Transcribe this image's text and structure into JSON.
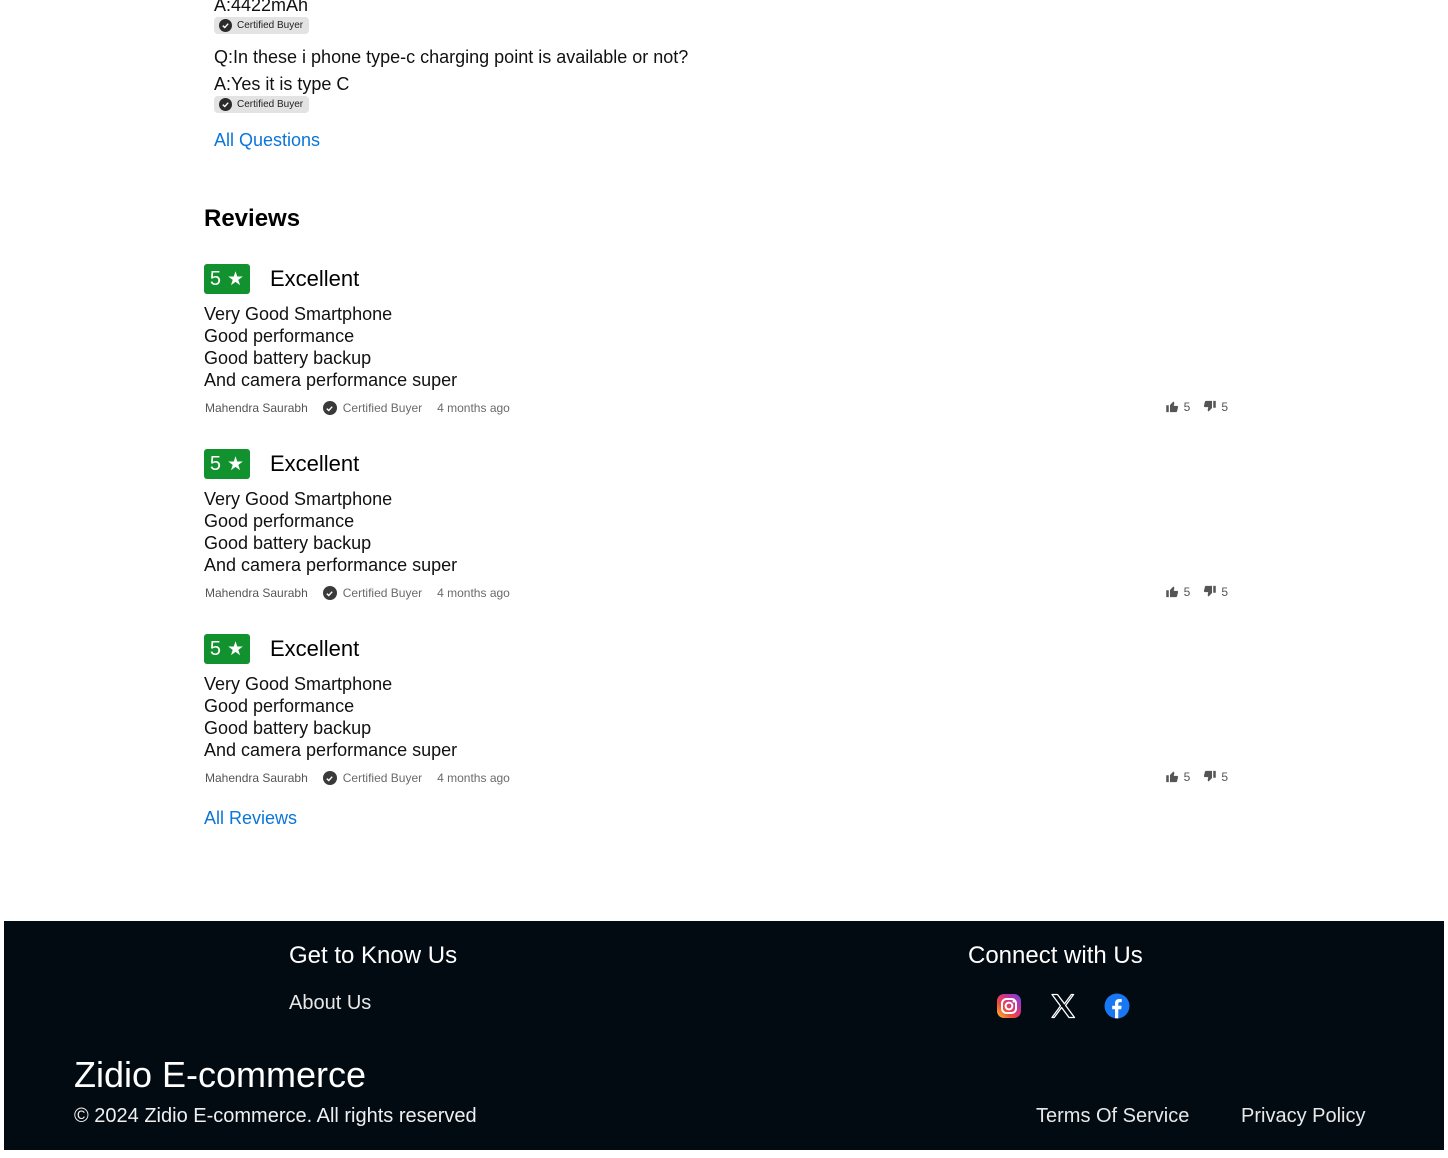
{
  "qa": {
    "prev_answer": "A:4422mAh",
    "certified_label": "Certified Buyer",
    "question": "Q:In these i phone type-c charging point is available or not?",
    "answer": "A:Yes it is type C",
    "all_questions": "All Questions"
  },
  "reviews": {
    "title": "Reviews",
    "all_reviews": "All Reviews",
    "items": [
      {
        "rating": "5",
        "headline": "Excellent",
        "lines": [
          "Very Good Smartphone",
          "Good performance",
          "Good battery backup",
          "And camera performance super"
        ],
        "author": "Mahendra Saurabh",
        "certified": "Certified Buyer",
        "time": "4 months ago",
        "likes": "5",
        "dislikes": "5"
      },
      {
        "rating": "5",
        "headline": "Excellent",
        "lines": [
          "Very Good Smartphone",
          "Good performance",
          "Good battery backup",
          "And camera performance super"
        ],
        "author": "Mahendra Saurabh",
        "certified": "Certified Buyer",
        "time": "4 months ago",
        "likes": "5",
        "dislikes": "5"
      },
      {
        "rating": "5",
        "headline": "Excellent",
        "lines": [
          "Very Good Smartphone",
          "Good performance",
          "Good battery backup",
          "And camera performance super"
        ],
        "author": "Mahendra Saurabh",
        "certified": "Certified Buyer",
        "time": "4 months ago",
        "likes": "5",
        "dislikes": "5"
      }
    ]
  },
  "footer": {
    "know_heading": "Get to Know Us",
    "about": "About Us",
    "connect_heading": "Connect with Us",
    "social_icons": [
      "instagram-icon",
      "x-icon",
      "facebook-icon"
    ],
    "brand": "Zidio E-commerce",
    "copyright": "© 2024 Zidio E-commerce. All rights reserved",
    "terms": "Terms Of Service",
    "privacy": "Privacy Policy"
  },
  "colors": {
    "link": "#0b75d9",
    "rating_badge": "#12922f",
    "footer_bg": "#020b12"
  }
}
